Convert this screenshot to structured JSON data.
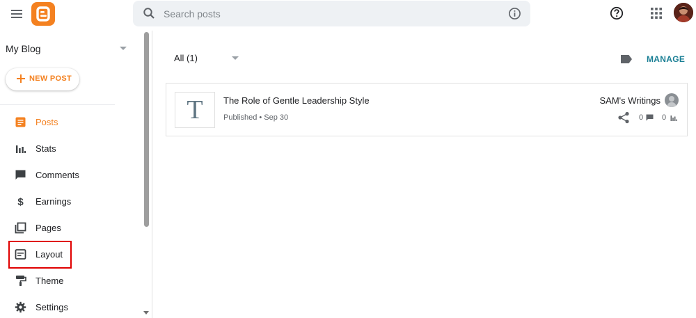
{
  "header": {
    "search": {
      "placeholder": "Search posts",
      "value": ""
    },
    "icons": [
      "menu-icon",
      "blogger-logo",
      "search-icon",
      "info-icon",
      "help-icon",
      "apps-icon",
      "avatar"
    ]
  },
  "sidebar": {
    "blog_name": "My Blog",
    "new_post_label": "NEW POST",
    "items": [
      {
        "label": "Posts",
        "icon": "posts-icon",
        "active": true
      },
      {
        "label": "Stats",
        "icon": "stats-icon"
      },
      {
        "label": "Comments",
        "icon": "comments-icon"
      },
      {
        "label": "Earnings",
        "icon": "dollar-icon"
      },
      {
        "label": "Pages",
        "icon": "pages-icon"
      },
      {
        "label": "Layout",
        "icon": "layout-icon",
        "highlighted": true
      },
      {
        "label": "Theme",
        "icon": "theme-icon"
      },
      {
        "label": "Settings",
        "icon": "gear-icon"
      }
    ]
  },
  "main": {
    "filter_label": "All (1)",
    "manage_label": "MANAGE",
    "posts": [
      {
        "thumb_letter": "T",
        "title": "The Role of Gentle Leadership Style",
        "meta": "Published • Sep 30",
        "author": "SAM's Writings",
        "comments": "0",
        "views": "0"
      }
    ]
  },
  "colors": {
    "accent": "#f48120",
    "manage": "#1a7f95",
    "highlight": "#e00000"
  }
}
